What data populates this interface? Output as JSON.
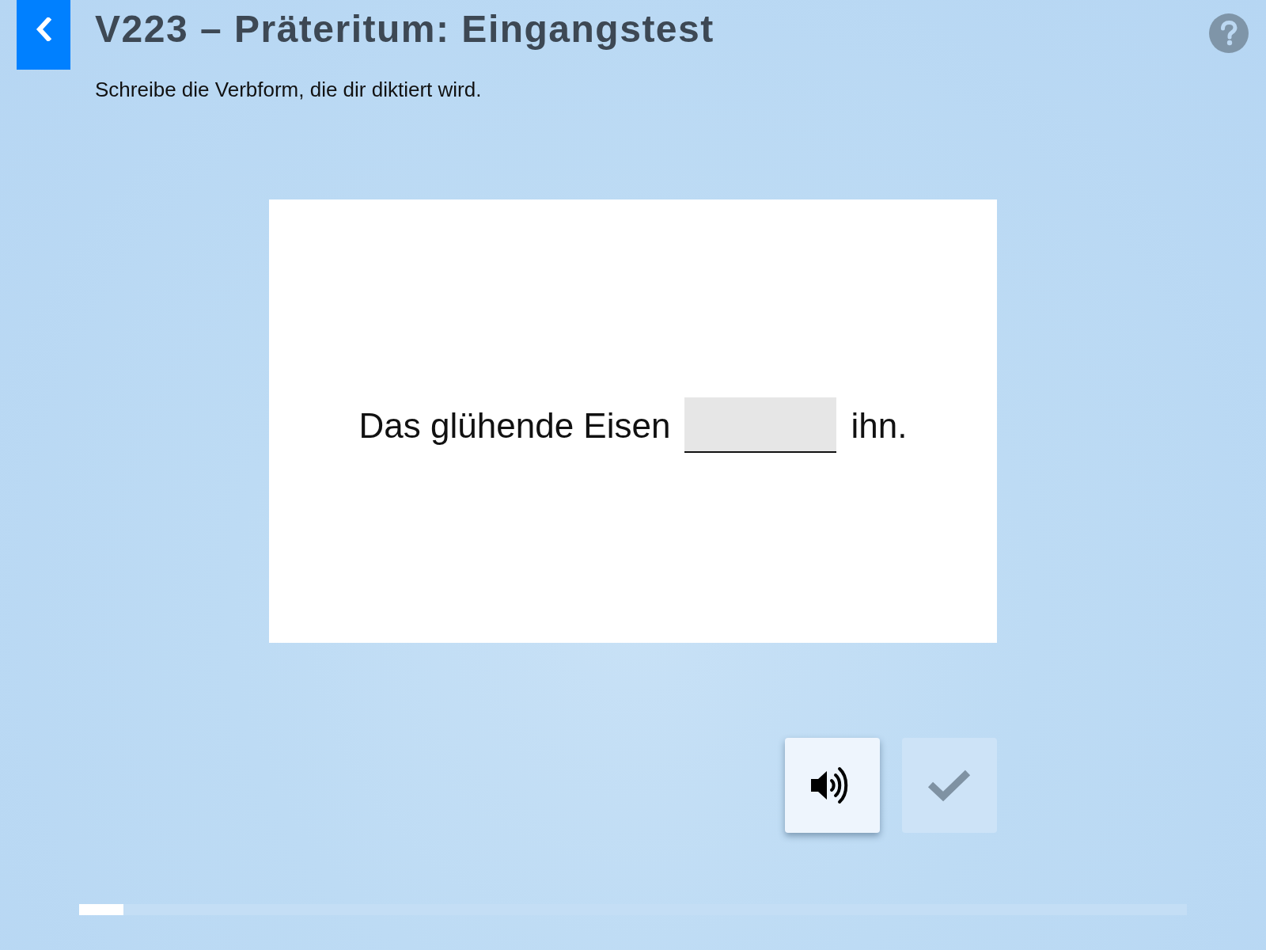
{
  "header": {
    "title": "V223 – Präteritum: Eingangstest",
    "instruction": "Schreibe die Verbform, die dir diktiert wird."
  },
  "exercise": {
    "sentence": [
      {
        "kind": "text",
        "text": "Das glühende Eisen"
      },
      {
        "kind": "blank"
      },
      {
        "kind": "text",
        "text": "ihn."
      }
    ]
  },
  "actions": [
    {
      "kind": "audio",
      "disabled": false
    },
    {
      "kind": "check",
      "disabled": true
    }
  ],
  "progress": {
    "level": 0.04
  }
}
